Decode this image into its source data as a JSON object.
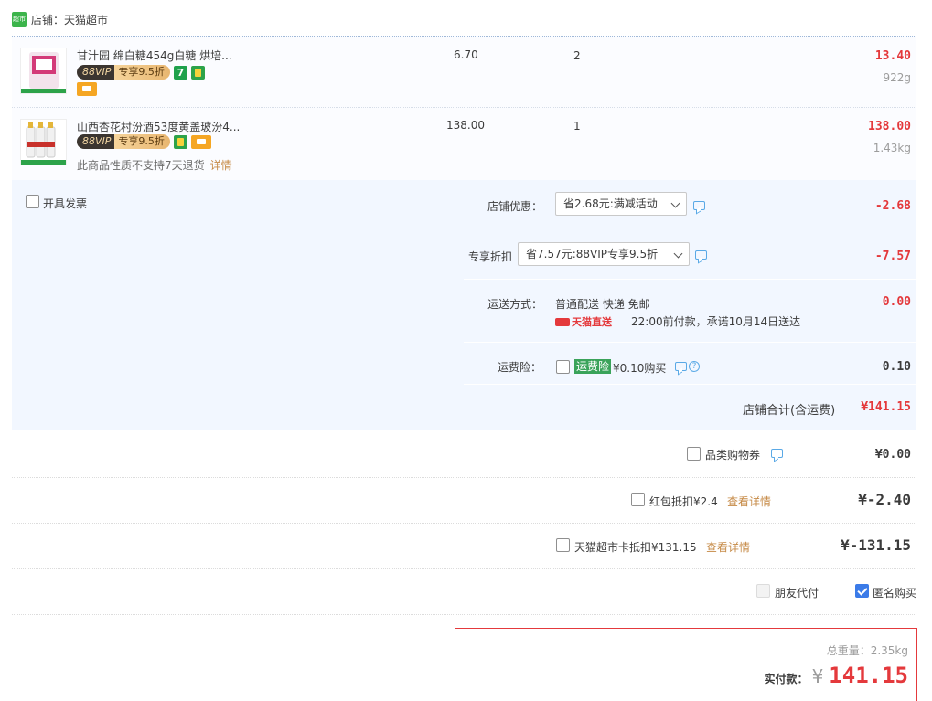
{
  "shop": {
    "logo_text": "超市",
    "label": "店铺：天猫超市"
  },
  "items": [
    {
      "title": "甘汁园 绵白糖454g白糖 烘培...",
      "vip_left": "88VIP",
      "vip_right": "专享9.5折",
      "icon7": "7",
      "price": "6.70",
      "qty": "2",
      "sum": "13.40",
      "weight": "922g"
    },
    {
      "title": "山西杏花村汾酒53度黄盖玻汾4...",
      "vip_left": "88VIP",
      "vip_right": "专享9.5折",
      "note": "此商品性质不支持7天退货",
      "note_link": "详情",
      "price": "138.00",
      "qty": "1",
      "sum": "138.00",
      "weight": "1.43kg"
    }
  ],
  "invoice": {
    "label": "开具发票"
  },
  "shop_discount": {
    "label": "店铺优惠：",
    "selected": "省2.68元:满减活动",
    "amount": "-2.68"
  },
  "vip_discount": {
    "label": "专享折扣",
    "selected": "省7.57元:88VIP专享9.5折",
    "amount": "-7.57"
  },
  "shipping": {
    "label": "运送方式：",
    "method": "普通配送 快递 免邮",
    "carrier": "天猫直送",
    "promise": "22:00前付款，承诺10月14日送达",
    "amount": "0.00"
  },
  "insurance": {
    "label": "运费险：",
    "tag": "运费险",
    "price_text": "¥0.10购买",
    "help": "?",
    "amount": "0.10"
  },
  "shop_total": {
    "label": "店铺合计(含运费)",
    "amount": "¥141.15"
  },
  "coupon": {
    "label": "品类购物券",
    "amount": "¥0.00"
  },
  "red_packet": {
    "label": "红包抵扣¥2.4",
    "link": "查看详情",
    "amount": "¥-2.40"
  },
  "tmall_card": {
    "label": "天猫超市卡抵扣¥131.15",
    "link": "查看详情",
    "amount": "¥-131.15"
  },
  "friend_pay": {
    "label": "朋友代付"
  },
  "anonymous": {
    "label": "匿名购买"
  },
  "payment": {
    "weight_label": "总重量：2.35kg",
    "pay_label": "实付款：",
    "currency": "¥",
    "amount": "141.15"
  },
  "colors": {
    "accent_red": "#e4393c",
    "panel_blue": "#f2f7ff",
    "vip_gold": "#e8b670"
  }
}
